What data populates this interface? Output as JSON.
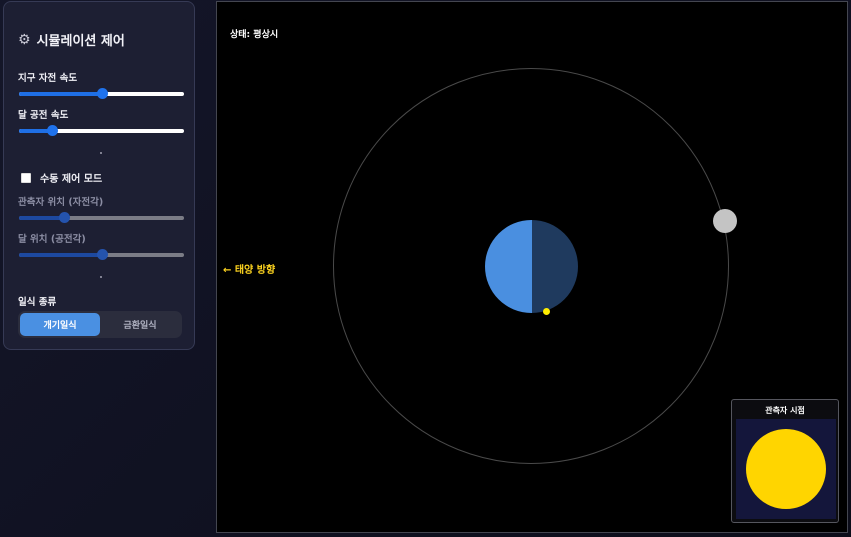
{
  "panel": {
    "title": "시뮬레이션 제어",
    "icon": "gear-icon",
    "earth_rotation": {
      "label": "지구 자전 속도",
      "value": 0.5
    },
    "moon_revolution": {
      "label": "달 공전 속도",
      "value": 0.2
    },
    "manual_mode": {
      "label": "수동 제어 모드",
      "checked": false
    },
    "observer_position": {
      "label": "관측자 위치 (자전각)",
      "value": 0.27
    },
    "moon_position": {
      "label": "달 위치 (공전각)",
      "value": 0.5
    },
    "eclipse_type": {
      "label": "일식 종류",
      "options": [
        "개기일식",
        "금환일식"
      ],
      "selected": "개기일식"
    }
  },
  "simulation": {
    "status": "상태: 평상시",
    "sun_direction": "← 태양 방향",
    "observer_view": {
      "title": "관측자 시점"
    },
    "colors": {
      "earth_day": "#4a8fe0",
      "earth_night": "#1f3a5e",
      "moon": "#c4c4c4",
      "observer": "#ffee00",
      "sun": "#ffd500",
      "sky": "#14163b"
    }
  }
}
